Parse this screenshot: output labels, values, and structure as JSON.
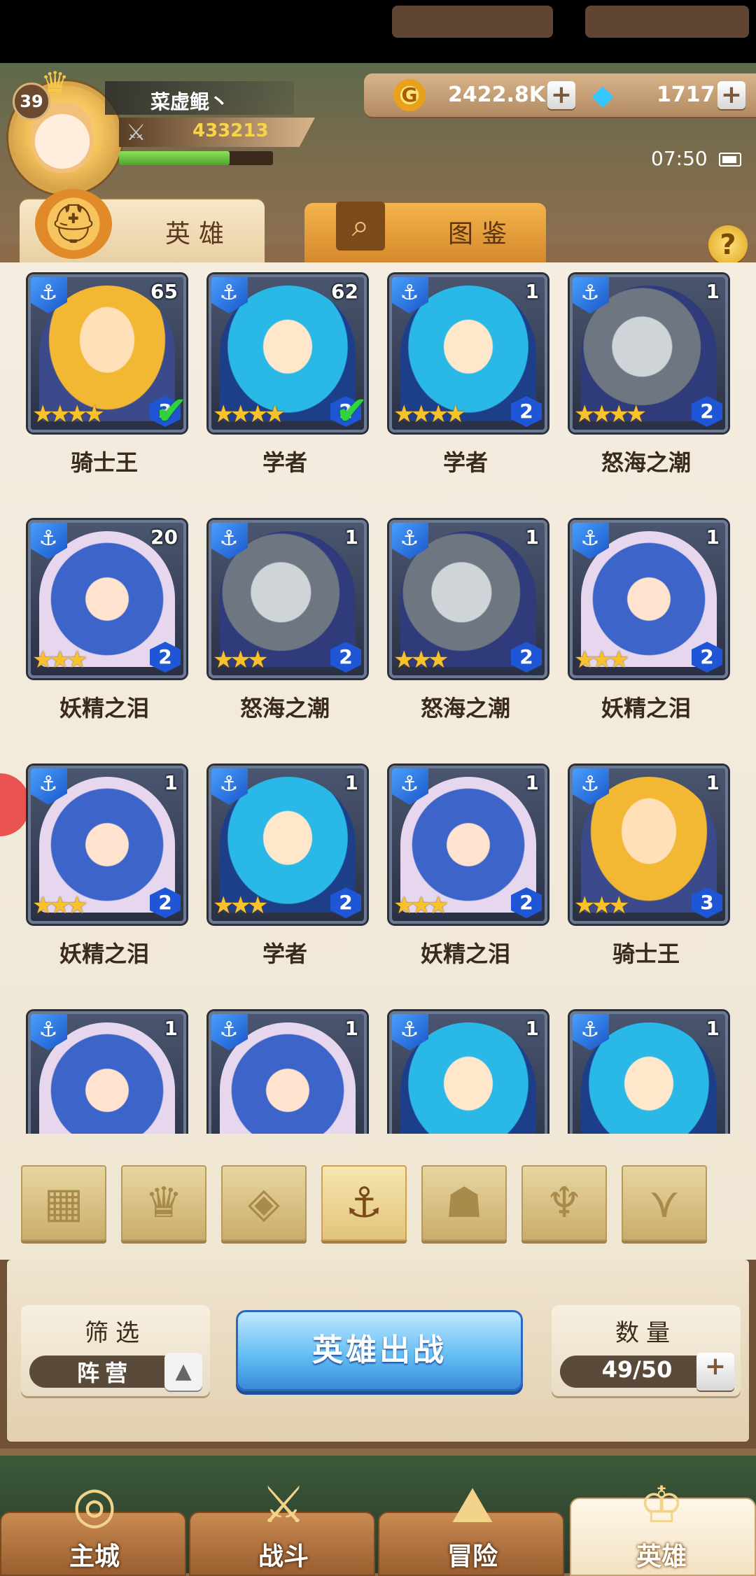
{
  "player": {
    "name": "菜虚鲲丶",
    "level": "39",
    "power": "433213",
    "hp_fraction": 0.72
  },
  "resources": {
    "gold_icon": "G",
    "gold": "2422.8K",
    "gems": "1717",
    "plus": "+"
  },
  "status": {
    "time": "07:50"
  },
  "tabs": {
    "hero": "英雄",
    "handbook": "图鉴",
    "help": "?"
  },
  "heroes": [
    {
      "name": "骑士王",
      "count": "65",
      "stars": "★★★★",
      "rank": "3",
      "check": true,
      "art": "knight"
    },
    {
      "name": "学者",
      "count": "62",
      "stars": "★★★★",
      "rank": "2",
      "check": true,
      "art": "scholar"
    },
    {
      "name": "学者",
      "count": "1",
      "stars": "★★★★",
      "rank": "2",
      "check": false,
      "art": "scholar"
    },
    {
      "name": "怒海之潮",
      "count": "1",
      "stars": "★★★★",
      "rank": "2",
      "check": false,
      "art": "tide"
    },
    {
      "name": "妖精之泪",
      "count": "20",
      "stars": "★★★",
      "rank": "2",
      "check": false,
      "art": "fairy"
    },
    {
      "name": "怒海之潮",
      "count": "1",
      "stars": "★★★",
      "rank": "2",
      "check": false,
      "art": "tide"
    },
    {
      "name": "怒海之潮",
      "count": "1",
      "stars": "★★★",
      "rank": "2",
      "check": false,
      "art": "tide"
    },
    {
      "name": "妖精之泪",
      "count": "1",
      "stars": "★★★",
      "rank": "2",
      "check": false,
      "art": "fairy"
    },
    {
      "name": "妖精之泪",
      "count": "1",
      "stars": "★★★",
      "rank": "2",
      "check": false,
      "art": "fairy"
    },
    {
      "name": "学者",
      "count": "1",
      "stars": "★★★",
      "rank": "2",
      "check": false,
      "art": "scholar"
    },
    {
      "name": "妖精之泪",
      "count": "1",
      "stars": "★★★",
      "rank": "2",
      "check": false,
      "art": "fairy"
    },
    {
      "name": "骑士王",
      "count": "1",
      "stars": "★★★",
      "rank": "3",
      "check": false,
      "art": "knight"
    },
    {
      "name": "",
      "count": "1",
      "stars": "",
      "rank": "",
      "check": false,
      "art": "fairy"
    },
    {
      "name": "",
      "count": "1",
      "stars": "",
      "rank": "",
      "check": false,
      "art": "fairy"
    },
    {
      "name": "",
      "count": "1",
      "stars": "",
      "rank": "",
      "check": false,
      "art": "scholar"
    },
    {
      "name": "",
      "count": "1",
      "stars": "",
      "rank": "",
      "check": false,
      "art": "scholar"
    }
  ],
  "filters": [
    {
      "icon": "grid-icon",
      "glyph": "▦",
      "active": false
    },
    {
      "icon": "crown-class-icon",
      "glyph": "♛",
      "active": false
    },
    {
      "icon": "diamond-class-icon",
      "glyph": "◈",
      "active": false
    },
    {
      "icon": "anchor-class-icon",
      "glyph": "⚓",
      "active": true
    },
    {
      "icon": "beast-class-icon",
      "glyph": "☗",
      "active": false
    },
    {
      "icon": "horns-class-icon",
      "glyph": "♆",
      "active": false
    },
    {
      "icon": "wings-class-icon",
      "glyph": "⋎",
      "active": false
    }
  ],
  "bottom": {
    "filter_label": "筛选",
    "filter_value": "阵营",
    "deploy_label": "英雄出战",
    "count_label": "数量",
    "count_value": "49/50"
  },
  "nav": [
    {
      "label": "主城",
      "icon": "city-icon",
      "glyph": "◎",
      "active": false
    },
    {
      "label": "战斗",
      "icon": "battle-icon",
      "glyph": "⚔",
      "active": false
    },
    {
      "label": "冒险",
      "icon": "adventure-icon",
      "glyph": "⛰",
      "active": false
    },
    {
      "label": "英雄",
      "icon": "hero-icon",
      "glyph": "♔",
      "active": true
    }
  ]
}
